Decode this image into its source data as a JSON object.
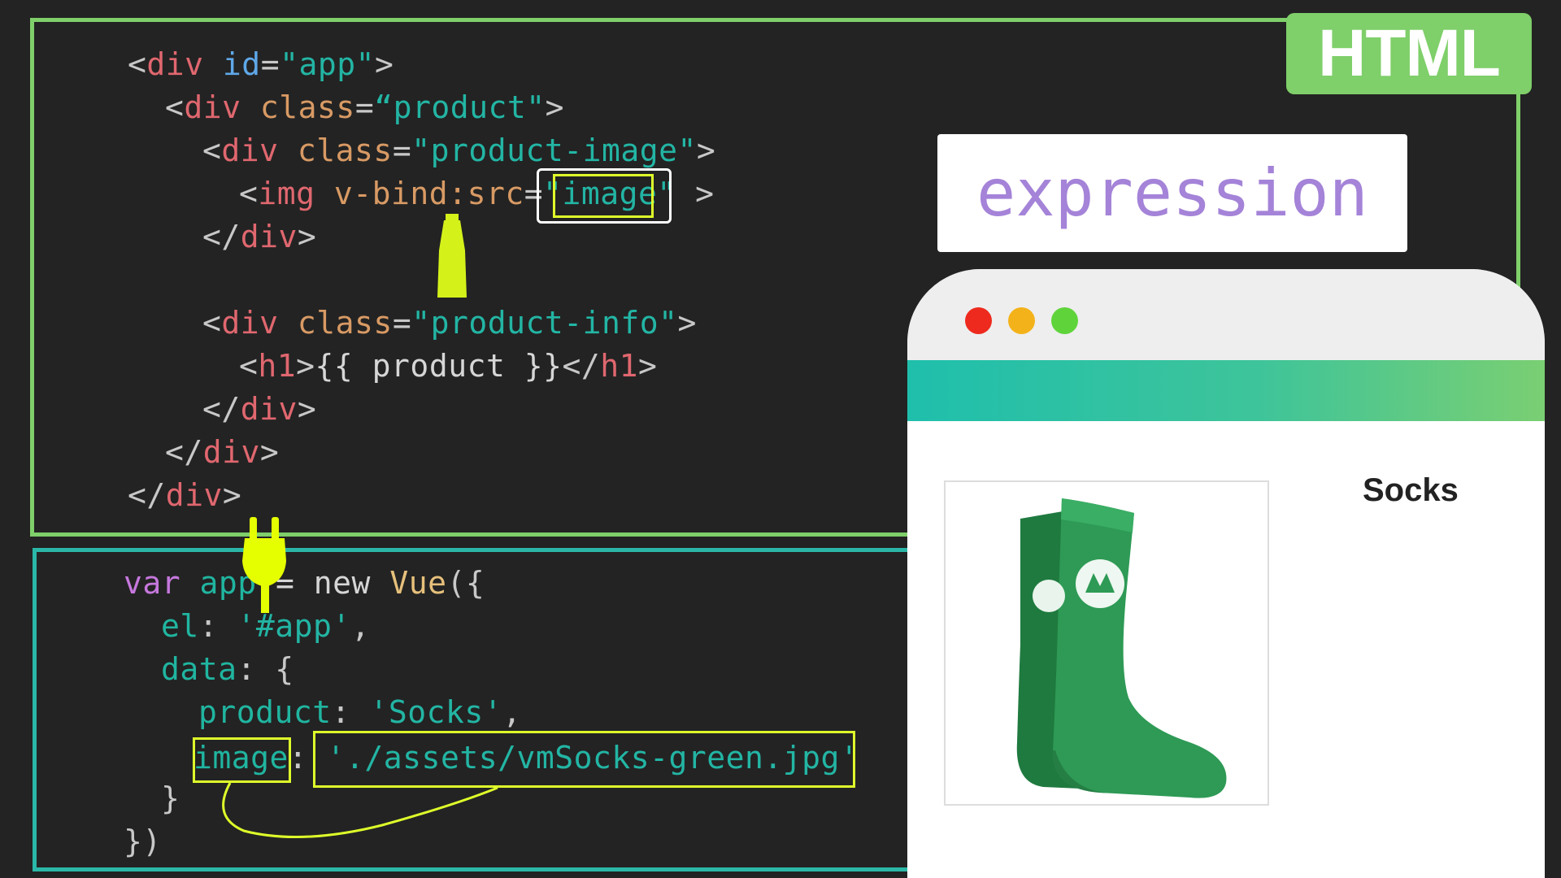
{
  "html_code": {
    "lines": [
      [
        [
          "punc",
          "<"
        ],
        [
          "tag",
          "div"
        ],
        [
          "plain",
          " "
        ],
        [
          "id",
          "id"
        ],
        [
          "punc",
          "="
        ],
        [
          "str",
          "\"app\""
        ],
        [
          "punc",
          ">"
        ]
      ],
      [
        [
          "punc",
          "<"
        ],
        [
          "tag",
          "div"
        ],
        [
          "plain",
          " "
        ],
        [
          "attr",
          "class"
        ],
        [
          "punc",
          "="
        ],
        [
          "str",
          "“product\""
        ],
        [
          "punc",
          ">"
        ]
      ],
      [
        [
          "punc",
          "<"
        ],
        [
          "tag",
          "div"
        ],
        [
          "plain",
          " "
        ],
        [
          "attr",
          "class"
        ],
        [
          "punc",
          "="
        ],
        [
          "str",
          "\"product-image\""
        ],
        [
          "punc",
          ">"
        ]
      ],
      [
        [
          "punc",
          "<"
        ],
        [
          "tag",
          "img"
        ],
        [
          "plain",
          " "
        ],
        [
          "attr",
          "v-bind:src"
        ],
        [
          "punc",
          "="
        ],
        [
          "str",
          "\"image\""
        ],
        [
          "punc",
          " >"
        ]
      ],
      [
        [
          "punc",
          "</"
        ],
        [
          "tag",
          "div"
        ],
        [
          "punc",
          ">"
        ]
      ],
      [
        [
          "punc",
          "<"
        ],
        [
          "tag",
          "div"
        ],
        [
          "plain",
          " "
        ],
        [
          "attr",
          "class"
        ],
        [
          "punc",
          "="
        ],
        [
          "str",
          "\"product-info\""
        ],
        [
          "punc",
          ">"
        ]
      ],
      [
        [
          "punc",
          "<"
        ],
        [
          "tag",
          "h1"
        ],
        [
          "punc",
          ">"
        ],
        [
          "plain",
          "{{ product }}"
        ],
        [
          "punc",
          "</"
        ],
        [
          "tag",
          "h1"
        ],
        [
          "punc",
          ">"
        ]
      ],
      [
        [
          "punc",
          "</"
        ],
        [
          "tag",
          "div"
        ],
        [
          "punc",
          ">"
        ]
      ],
      [
        [
          "punc",
          "</"
        ],
        [
          "tag",
          "div"
        ],
        [
          "punc",
          ">"
        ]
      ],
      [
        [
          "punc",
          "</"
        ],
        [
          "tag",
          "div"
        ],
        [
          "punc",
          ">"
        ]
      ]
    ]
  },
  "js_code": {
    "lines": [
      [
        [
          "key",
          "var"
        ],
        [
          "plain",
          " "
        ],
        [
          "prop",
          "app"
        ],
        [
          "plain",
          " = new "
        ],
        [
          "cls",
          "Vue"
        ],
        [
          "punc",
          "({"
        ]
      ],
      [
        [
          "prop",
          "el"
        ],
        [
          "punc",
          ":"
        ],
        [
          "plain",
          " "
        ],
        [
          "str",
          "'#app'"
        ],
        [
          "punc",
          ","
        ]
      ],
      [
        [
          "prop",
          "data"
        ],
        [
          "punc",
          ":"
        ],
        [
          "plain",
          " "
        ],
        [
          "punc",
          "{"
        ]
      ],
      [
        [
          "prop",
          "product"
        ],
        [
          "punc",
          ":"
        ],
        [
          "plain",
          " "
        ],
        [
          "str",
          "'Socks'"
        ],
        [
          "punc",
          ","
        ]
      ],
      [
        [
          "prop",
          "image"
        ],
        [
          "punc",
          ":"
        ],
        [
          "plain",
          " "
        ],
        [
          "str",
          "'./assets/vmSocks-green.jpg'"
        ]
      ],
      [
        [
          "punc",
          "}"
        ]
      ],
      [
        [
          "punc",
          "})"
        ]
      ]
    ]
  },
  "badge": {
    "label": "HTML"
  },
  "expression_label": "expression",
  "browser": {
    "product_title": "Socks",
    "product_image_icon": "green-sock-image"
  },
  "colors": {
    "html_border": "#7fcf6a",
    "js_border": "#2bb7a7",
    "highlight_yellow": "#dfff2a",
    "expression_text": "#a483d8",
    "sock_green": "#2e9a55"
  }
}
